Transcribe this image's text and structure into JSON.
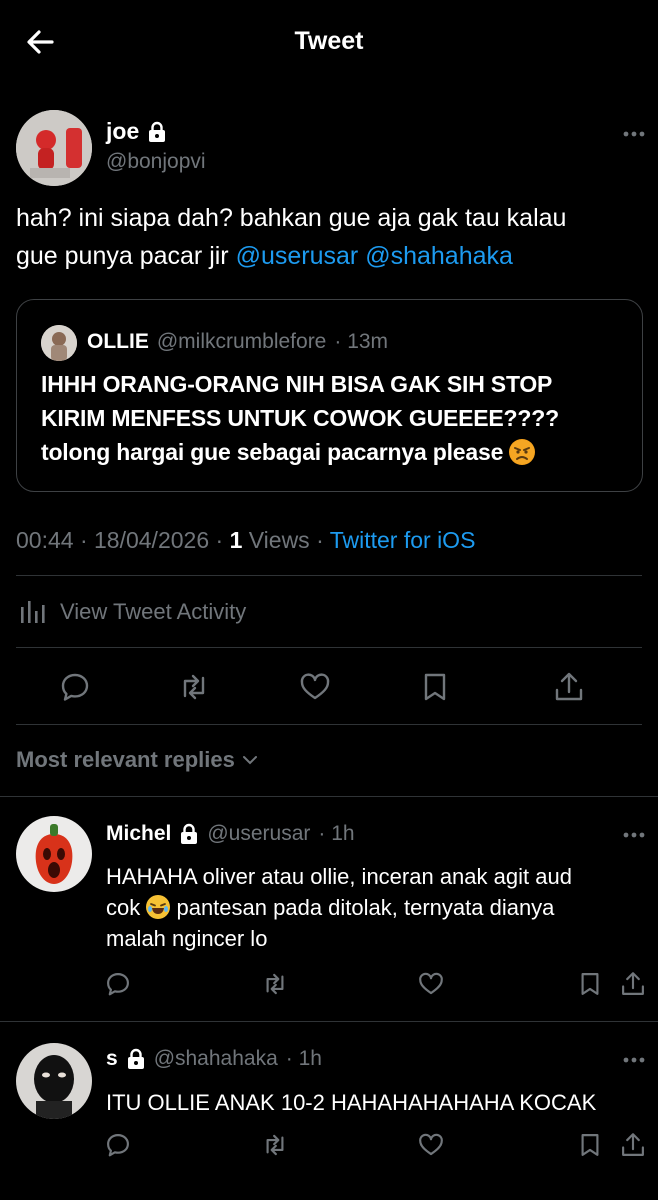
{
  "header": {
    "title": "Tweet"
  },
  "tweet": {
    "name": "joe",
    "handle": "@bonjopvi",
    "text_line1": "hah? ini siapa dah? bahkan gue aja gak tau kalau",
    "text_line2": "gue punya pacar jir ",
    "mention1": "@userusar",
    "mention2": "@shahahaka",
    "quote": {
      "name": "OLLIE",
      "handle": "@milkcrumblefore",
      "time": "· 13m",
      "line1": "IHHH ORANG-ORANG NIH BISA GAK SIH STOP",
      "line2": "KIRIM MENFESS UNTUK COWOK GUEEEE????",
      "line3": "tolong hargai gue sebagai pacarnya please "
    },
    "time": "00:44 · 18/04/2026 · ",
    "views_count": "1",
    "views_label": " Views · ",
    "source": "Twitter for iOS",
    "activity_label": "View Tweet Activity"
  },
  "sort_label": "Most relevant replies",
  "replies": [
    {
      "name": "Michel",
      "handle": "@userusar",
      "time": "· 1h",
      "line1": "HAHAHA oliver atau ollie, inceran anak agit aud",
      "line2a": "cok ",
      "line2b": " pantesan pada ditolak, ternyata dianya",
      "line3": "malah ngincer lo"
    },
    {
      "name": "s",
      "handle": "@shahahaka",
      "time": "· 1h",
      "line1": "ITU OLLIE ANAK 10-2 HAHAHAHAHAHA KOCAK"
    }
  ],
  "colors": {
    "accent": "#1d9bf0",
    "background": "#000000",
    "muted": "#71767b",
    "divider": "#2f3336"
  },
  "icons": [
    "back-arrow-icon",
    "lock-icon",
    "more-icon",
    "analytics-icon",
    "reply-icon",
    "retweet-icon",
    "like-icon",
    "bookmark-icon",
    "share-icon",
    "chevron-down-icon",
    "angry-face-emoji",
    "laughing-emoji"
  ]
}
